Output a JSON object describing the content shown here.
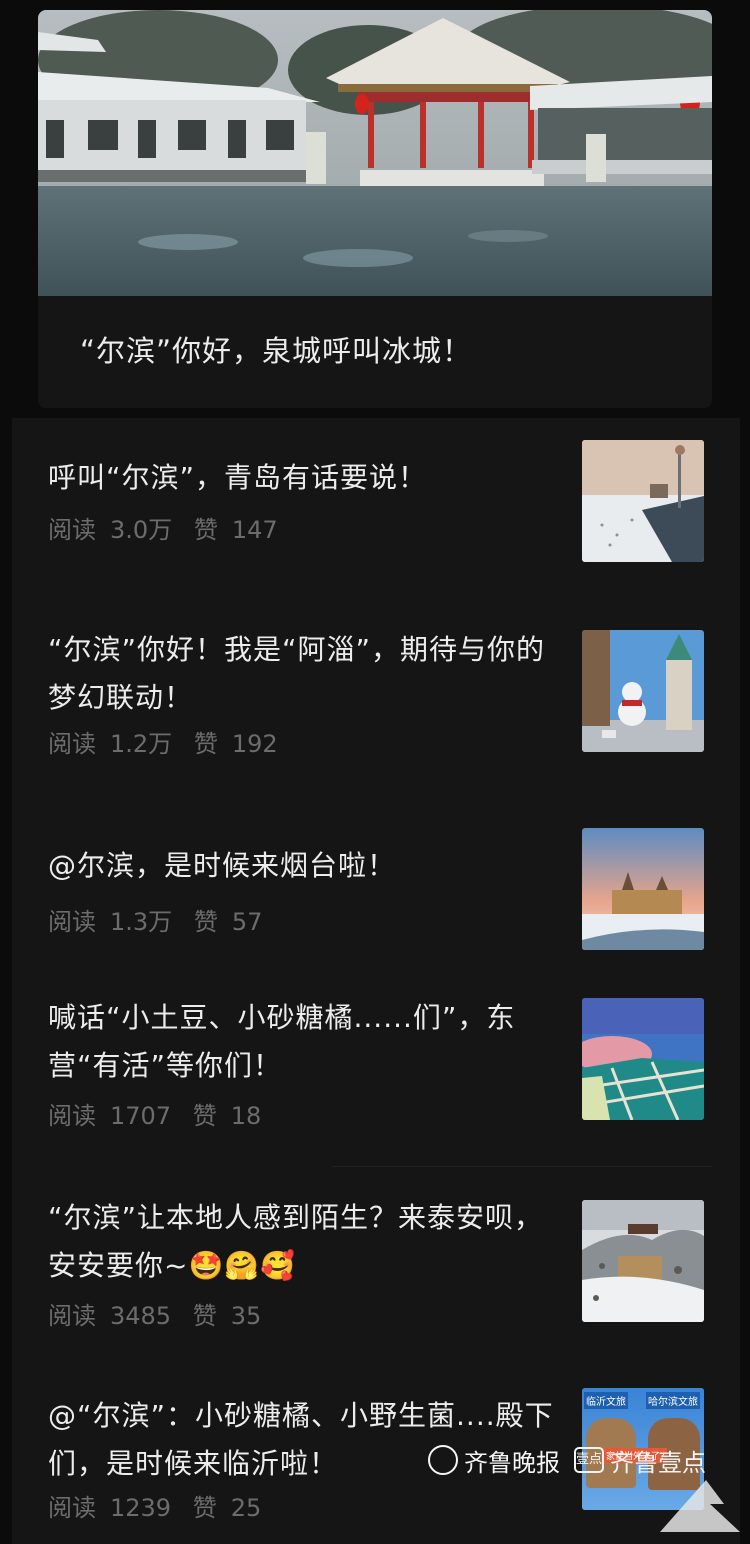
{
  "hero": {
    "title": "“尔滨”你好，泉城呼叫冰城！",
    "image": "pavilion-spring-snow-image"
  },
  "items": [
    {
      "title": "呼叫“尔滨”，青岛有话要说！",
      "read_label": "阅读",
      "read": "3.0万",
      "like_label": "赞",
      "likes": "147",
      "thumb": "seaside-pier-snow-image"
    },
    {
      "title": "“尔滨”你好！我是“阿淄”，期待与你的梦幻联动！",
      "read_label": "阅读",
      "read": "1.2万",
      "like_label": "赞",
      "likes": "192",
      "thumb": "snowman-tower-image"
    },
    {
      "title": "@尔滨，是时候来烟台啦！",
      "read_label": "阅读",
      "read": "1.3万",
      "like_label": "赞",
      "likes": "57",
      "thumb": "castle-sunset-image"
    },
    {
      "title": "喊话“小土豆、小砂糖橘......们”，东营“有活”等你们！",
      "read_label": "阅读",
      "read": "1707",
      "like_label": "赞",
      "likes": "18",
      "thumb": "salt-fields-aerial-image"
    },
    {
      "title": "“尔滨”让本地人感到陌生？来泰安呗，安安要你~🤩🤗🥰",
      "read_label": "阅读",
      "read": "3485",
      "like_label": "赞",
      "likes": "35",
      "thumb": "mountain-gate-snow-image"
    },
    {
      "title": "@“尔滨”：小砂糖橘、小野生菌....殿下们，是时候来临沂啦！",
      "read_label": "阅读",
      "read": "1239",
      "like_label": "赞",
      "likes": "25",
      "thumb": "linyi-culture-poster-image"
    }
  ],
  "thumb_texts": {
    "left_tag": "临沂文旅",
    "right_tag": "哈尔滨文旅",
    "caption": "家住当外人了?"
  },
  "watermark": {
    "brand1": "齐鲁晚报",
    "box": "壹点",
    "brand2": "齐鲁壹点"
  },
  "colors": {
    "background": "#0b0b0c",
    "card": "#151516",
    "text": "#ececec",
    "meta": "#6c6c6c"
  }
}
